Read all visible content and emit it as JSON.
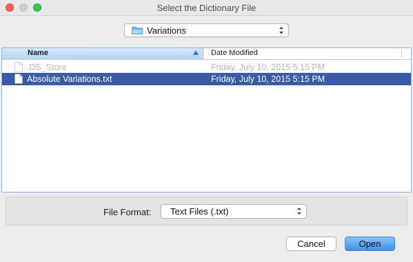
{
  "window": {
    "title": "Select the Dictionary File"
  },
  "folder_popup": {
    "value": "Variations",
    "icon": "folder-icon"
  },
  "file_list": {
    "columns": [
      "Name",
      "Date Modified"
    ],
    "sort_column": "Name",
    "sort_direction": "ascending",
    "rows": [
      {
        "name": ".DS_Store",
        "date": "Friday, July 10, 2015 5:15 PM",
        "enabled": false,
        "selected": false
      },
      {
        "name": "Absolute Variations.txt",
        "date": "Friday, July 10, 2015 5:15 PM",
        "enabled": true,
        "selected": true
      }
    ]
  },
  "format": {
    "label": "File Format:",
    "value": "Text Files (.txt)"
  },
  "buttons": {
    "cancel": "Cancel",
    "open": "Open"
  },
  "colors": {
    "selection": "#3a5aa6",
    "close": "#fc605b",
    "maximize": "#34c84a",
    "default_button": "#3f8fe8"
  }
}
